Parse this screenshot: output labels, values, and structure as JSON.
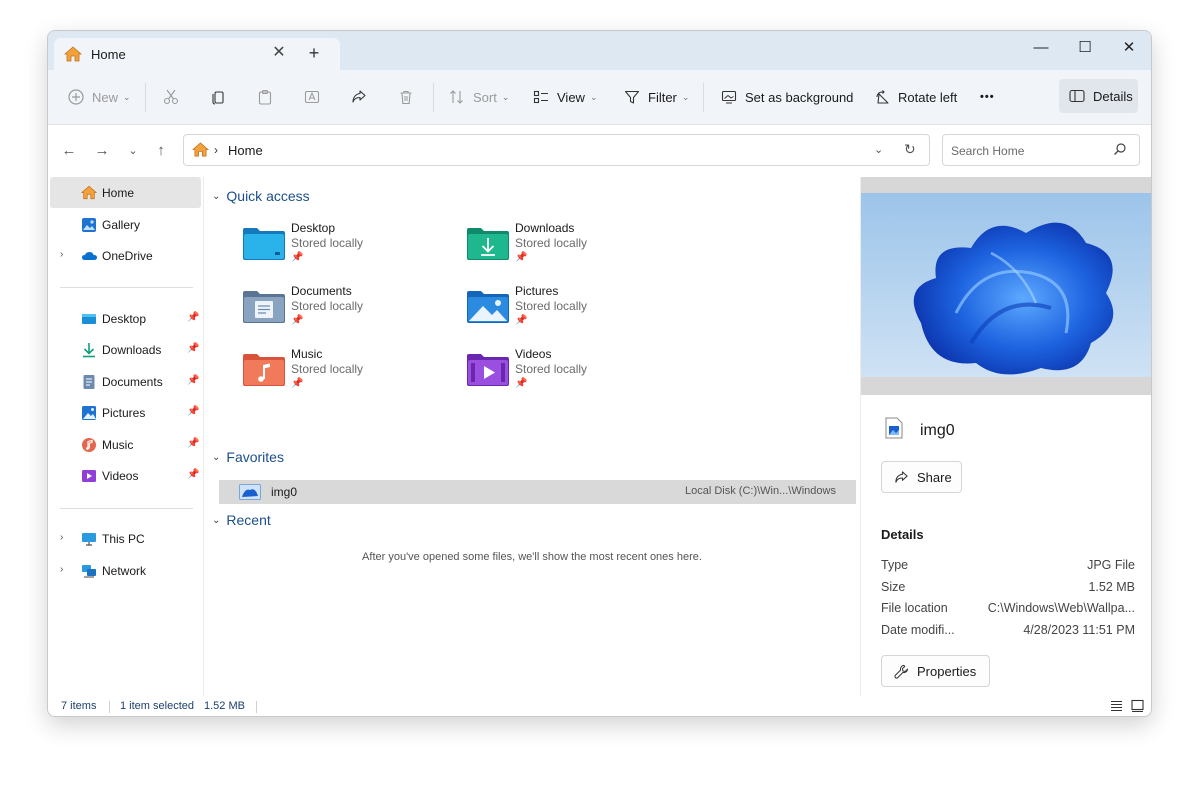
{
  "tab": {
    "title": "Home",
    "close": "✕",
    "new_tab": "+"
  },
  "window_controls": {
    "minimize": "—",
    "maximize": "☐",
    "close": "✕"
  },
  "toolbar": {
    "new_label": "New",
    "sort_label": "Sort",
    "view_label": "View",
    "filter_label": "Filter",
    "set_background_label": "Set as background",
    "rotate_left_label": "Rotate left",
    "more_label": "•••",
    "details_label": "Details"
  },
  "address": {
    "crumb": "Home",
    "separator": "›"
  },
  "search": {
    "placeholder": "Search Home"
  },
  "sidebar": {
    "items": [
      {
        "label": "Home",
        "icon": "home-icon",
        "selected": true
      },
      {
        "label": "Gallery",
        "icon": "gallery-icon"
      },
      {
        "label": "OneDrive",
        "icon": "onedrive-icon",
        "expandable": true
      }
    ],
    "pinned": [
      {
        "label": "Desktop",
        "icon": "desktop-icon"
      },
      {
        "label": "Downloads",
        "icon": "downloads-icon"
      },
      {
        "label": "Documents",
        "icon": "documents-icon"
      },
      {
        "label": "Pictures",
        "icon": "pictures-icon"
      },
      {
        "label": "Music",
        "icon": "music-icon"
      },
      {
        "label": "Videos",
        "icon": "videos-icon"
      }
    ],
    "drives": [
      {
        "label": "This PC",
        "icon": "this-pc-icon"
      },
      {
        "label": "Network",
        "icon": "network-icon"
      }
    ]
  },
  "quick_access": {
    "title": "Quick access",
    "folders": [
      {
        "name": "Desktop",
        "sub": "Stored locally"
      },
      {
        "name": "Downloads",
        "sub": "Stored locally"
      },
      {
        "name": "Documents",
        "sub": "Stored locally"
      },
      {
        "name": "Pictures",
        "sub": "Stored locally"
      },
      {
        "name": "Music",
        "sub": "Stored locally"
      },
      {
        "name": "Videos",
        "sub": "Stored locally"
      }
    ]
  },
  "favorites": {
    "title": "Favorites",
    "items": [
      {
        "name": "img0",
        "location": "Local Disk (C:)\\Win...\\Windows"
      }
    ]
  },
  "recent": {
    "title": "Recent",
    "empty_message": "After you've opened some files, we'll show the most recent ones here."
  },
  "details_pane": {
    "file_name": "img0",
    "share_label": "Share",
    "heading": "Details",
    "rows": [
      {
        "key": "Type",
        "value": "JPG File"
      },
      {
        "key": "Size",
        "value": "1.52 MB"
      },
      {
        "key": "File location",
        "value": "C:\\Windows\\Web\\Wallpa..."
      },
      {
        "key": "Date modifi...",
        "value": "4/28/2023 11:51 PM"
      }
    ],
    "properties_label": "Properties"
  },
  "status_bar": {
    "items": "7 items",
    "selected": "1 item selected",
    "size": "1.52 MB"
  },
  "colors": {
    "accent": "#1c4f8c",
    "titlebar": "#dde8f3",
    "commandbar": "#f1f5f9",
    "selection": "#d9d9d9"
  }
}
